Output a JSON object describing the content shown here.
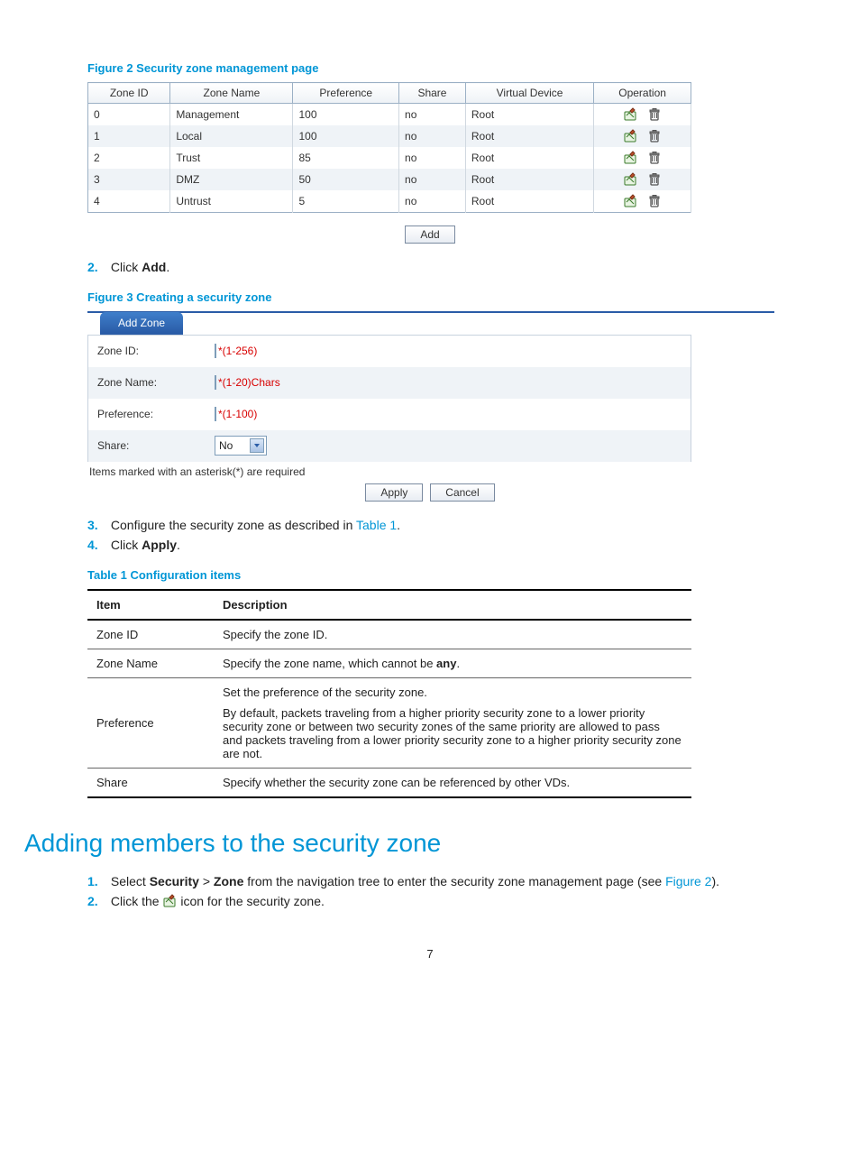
{
  "fig2_caption": "Figure 2 Security zone management page",
  "zone_table": {
    "headers": [
      "Zone ID",
      "Zone Name",
      "Preference",
      "Share",
      "Virtual Device",
      "Operation"
    ],
    "rows": [
      {
        "id": "0",
        "name": "Management",
        "pref": "100",
        "share": "no",
        "vd": "Root"
      },
      {
        "id": "1",
        "name": "Local",
        "pref": "100",
        "share": "no",
        "vd": "Root"
      },
      {
        "id": "2",
        "name": "Trust",
        "pref": "85",
        "share": "no",
        "vd": "Root"
      },
      {
        "id": "3",
        "name": "DMZ",
        "pref": "50",
        "share": "no",
        "vd": "Root"
      },
      {
        "id": "4",
        "name": "Untrust",
        "pref": "5",
        "share": "no",
        "vd": "Root"
      }
    ]
  },
  "add_btn": "Add",
  "step2_prefix": "Click ",
  "step2_bold": "Add",
  "step2_suffix": ".",
  "fig3_caption": "Figure 3 Creating a security zone",
  "tab_label": "Add Zone",
  "form": {
    "zone_id_label": "Zone ID:",
    "zone_id_hint": "*(1-256)",
    "zone_name_label": "Zone Name:",
    "zone_name_hint": "*(1-20)Chars",
    "pref_label": "Preference:",
    "pref_hint": "*(1-100)",
    "share_label": "Share:",
    "share_value": "No"
  },
  "required_note": "Items marked with an asterisk(*) are required",
  "apply_btn": "Apply",
  "cancel_btn": "Cancel",
  "step3_prefix": "Configure the security zone as described in ",
  "step3_link": "Table 1",
  "step3_suffix": ".",
  "step4_prefix": "Click ",
  "step4_bold": "Apply",
  "step4_suffix": ".",
  "table1_caption": "Table 1 Configuration items",
  "config_table": {
    "h1": "Item",
    "h2": "Description",
    "r1_item": "Zone ID",
    "r1_desc": "Specify the zone ID.",
    "r2_item": "Zone Name",
    "r2_desc_pre": "Specify the zone name, which cannot be ",
    "r2_desc_bold": "any",
    "r2_desc_post": ".",
    "r3_item": "Preference",
    "r3_d1": "Set the preference of the security zone.",
    "r3_d2": "By default, packets traveling from a higher priority security zone to a lower priority security zone or between two security zones of the same priority are allowed to pass and packets traveling from a lower priority security zone to a higher priority security zone are not.",
    "r4_item": "Share",
    "r4_desc": "Specify whether the security zone can be referenced by other VDs."
  },
  "section_heading": "Adding members to the security zone",
  "s1_prefix": "Select ",
  "s1_b1": "Security",
  "s1_mid": " > ",
  "s1_b2": "Zone",
  "s1_tail": " from the navigation tree to enter the security zone management page (see ",
  "s1_link": "Figure 2",
  "s1_end": ").",
  "s2_prefix": "Click the ",
  "s2_suffix": " icon for the security zone.",
  "page_number": "7"
}
